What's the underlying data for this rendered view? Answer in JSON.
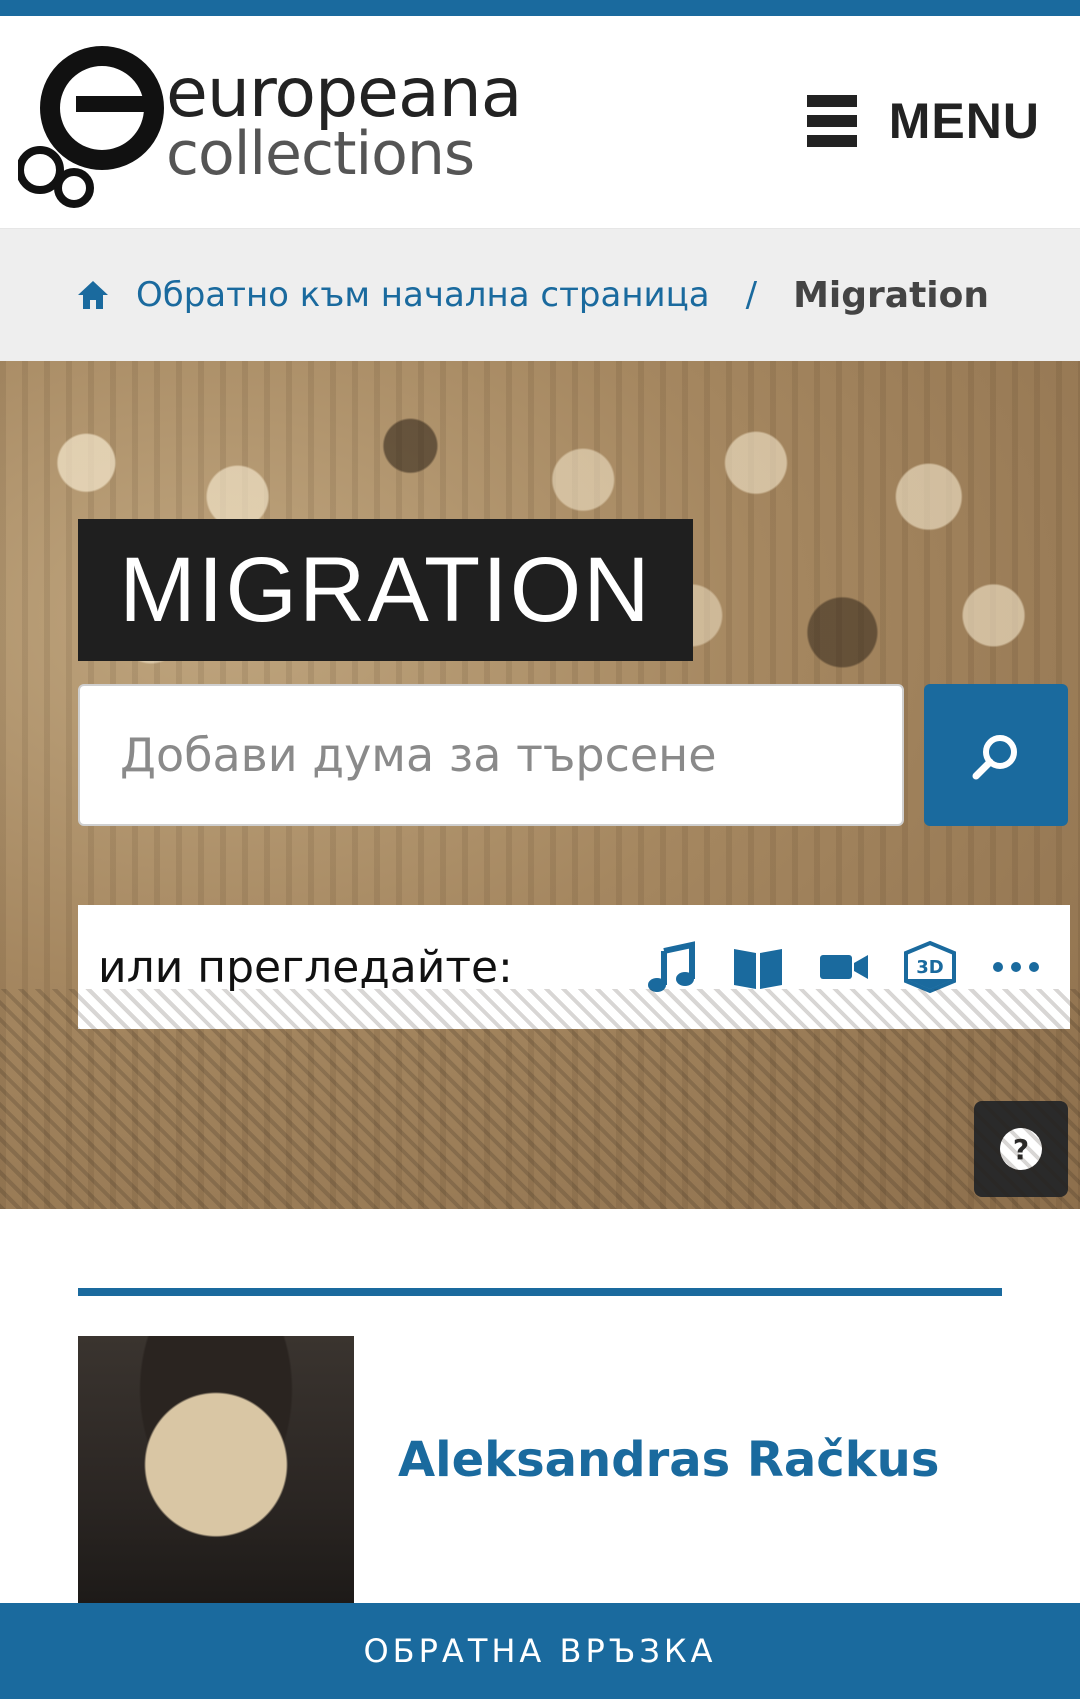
{
  "header": {
    "logo_line1": "europeana",
    "logo_line2": "collections",
    "menu_label": "MENU"
  },
  "breadcrumb": {
    "home_label": "Обратно към начална страница",
    "separator": "/",
    "current": "Migration"
  },
  "hero": {
    "title": "MIGRATION",
    "search_placeholder": "Добави дума за търсене",
    "browse_label": "или прегледайте:",
    "browse_icons": [
      "music-note-icon",
      "book-icon",
      "video-camera-icon",
      "3d-icon",
      "more-icon"
    ]
  },
  "content": {
    "featured_title": "Aleksandras Račkus"
  },
  "footer": {
    "feedback_label": "ОБРАТНА ВРЪЗКА"
  },
  "colors": {
    "accent": "#1a6a9e",
    "dark": "#1f1f1f",
    "breadcrumb_bg": "#eeeeee"
  }
}
